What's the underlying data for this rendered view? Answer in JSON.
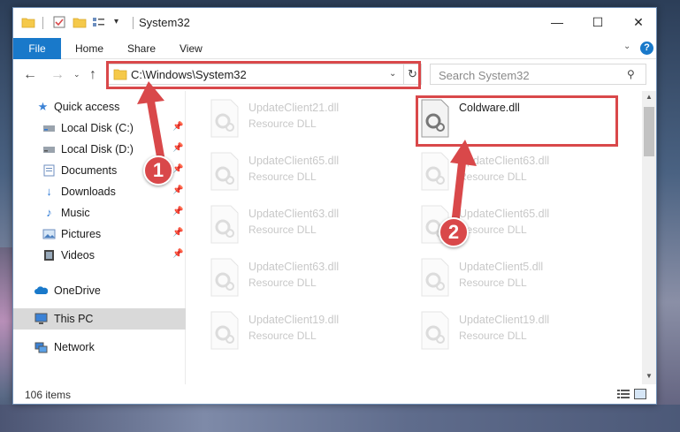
{
  "window": {
    "title": "System32",
    "controls": {
      "minimize": "—",
      "maximize": "☐",
      "close": "✕"
    }
  },
  "ribbon": {
    "tabs": [
      "File",
      "Home",
      "Share",
      "View"
    ]
  },
  "nav": {
    "address": "C:\\Windows\\System32",
    "search_placeholder": "Search System32"
  },
  "sidebar": {
    "items": [
      {
        "label": "Quick access",
        "icon": "star-icon",
        "pinned": false
      },
      {
        "label": "Local Disk (C:)",
        "icon": "drive-icon",
        "pinned": true
      },
      {
        "label": "Local Disk (D:)",
        "icon": "drive-icon",
        "pinned": true
      },
      {
        "label": "Documents",
        "icon": "documents-icon",
        "pinned": true
      },
      {
        "label": "Downloads",
        "icon": "download-icon",
        "pinned": true
      },
      {
        "label": "Music",
        "icon": "music-icon",
        "pinned": true
      },
      {
        "label": "Pictures",
        "icon": "pictures-icon",
        "pinned": true
      },
      {
        "label": "Videos",
        "icon": "videos-icon",
        "pinned": true
      },
      {
        "label": "OneDrive",
        "icon": "cloud-icon",
        "pinned": false
      },
      {
        "label": "This PC",
        "icon": "computer-icon",
        "pinned": false,
        "selected": true
      },
      {
        "label": "Network",
        "icon": "network-icon",
        "pinned": false
      }
    ]
  },
  "files": {
    "left": [
      {
        "name": "UpdateClient21.dll",
        "type": "Resource DLL"
      },
      {
        "name": "UpdateClient65.dll",
        "type": "Resource DLL"
      },
      {
        "name": "UpdateClient63.dll",
        "type": "Resource DLL"
      },
      {
        "name": "UpdateClient63.dll",
        "type": "Resource DLL"
      },
      {
        "name": "UpdateClient19.dll",
        "type": "Resource DLL"
      }
    ],
    "right": [
      {
        "name": "Coldware.dll",
        "type": ""
      },
      {
        "name": "UpdateClient63.dll",
        "type": "Resource DLL"
      },
      {
        "name": "UpdateClient65.dll",
        "type": "Resource DLL"
      },
      {
        "name": "UpdateClient5.dll",
        "type": "Resource DLL"
      },
      {
        "name": "UpdateClient19.dll",
        "type": "Resource DLL"
      }
    ]
  },
  "status": {
    "item_count": "106 items"
  },
  "annotations": {
    "step1": "1",
    "step2": "2",
    "color": "#d9484a"
  }
}
